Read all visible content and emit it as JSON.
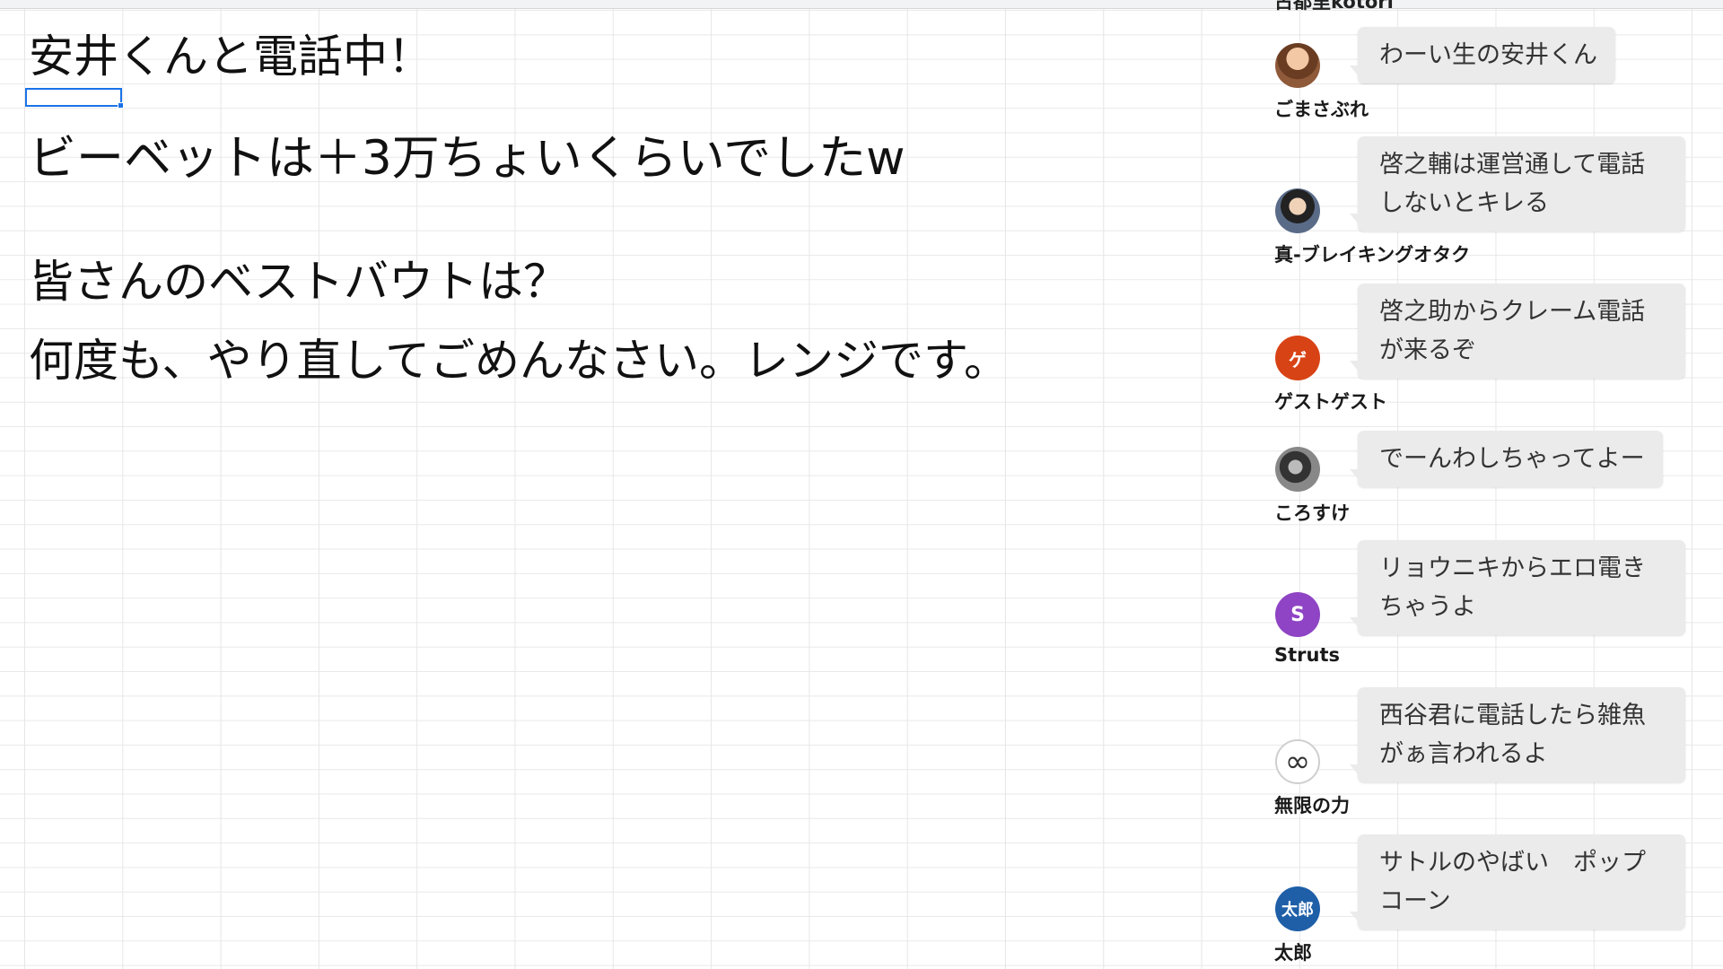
{
  "sheet": {
    "lines": [
      "安井くんと電話中！",
      "ビーベットは＋3万ちょいくらいでしたw",
      "皆さんのベストバウトは？",
      "何度も、やり直してごめんなさい。レンジです。"
    ]
  },
  "chat": {
    "top_user": "古都里kotori",
    "messages": [
      {
        "user": "ごまさぶれ",
        "avatar": "photo",
        "text": "わーい生の安井くん"
      },
      {
        "user": "真-ブレイキングオタク",
        "avatar": "photo",
        "text": "啓之輔は運営通して電話しないとキレる"
      },
      {
        "user": "ゲストゲスト",
        "avatar": "ゲ",
        "text": "啓之助からクレーム電話が来るぞ"
      },
      {
        "user": "ころすけ",
        "avatar": "photo",
        "text": "でーんわしちゃってよー"
      },
      {
        "user": "Struts",
        "avatar": "S",
        "text": "リョウニキからエロ電きちゃうよ"
      },
      {
        "user": "無限の力",
        "avatar": "∞",
        "text": "西谷君に電話したら雑魚がぁ言われるよ"
      },
      {
        "user": "太郎",
        "avatar": "太郎",
        "text": "サトルのやばい　ポップコーン"
      }
    ]
  },
  "colors": {
    "selection": "#1a73e8",
    "bubble": "#ebebeb",
    "ge_avatar": "#d84315",
    "s_avatar": "#8e44c4",
    "taro_avatar": "#1f5fa8"
  },
  "icons": [
    "user-avatar-photo",
    "infinity-icon"
  ]
}
